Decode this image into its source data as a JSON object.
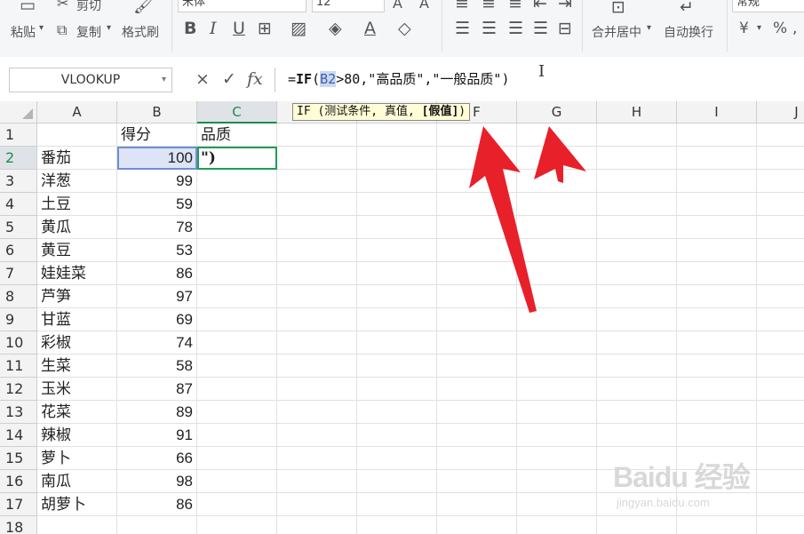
{
  "ribbon": {
    "paste_label": "粘贴",
    "cut_label": "剪切",
    "copy_label": "复制",
    "format_painter_label": "格式刷",
    "font_name": "宋体",
    "font_size": "12",
    "merge_center_label": "合并居中",
    "wrap_text_label": "自动换行",
    "number_format": "常规",
    "currency_symbol": "¥",
    "percent_symbol": "%"
  },
  "formula_bar": {
    "name_box": "VLOOKUP",
    "cancel_symbol": "×",
    "enter_symbol": "✓",
    "fx_label": "fx",
    "formula_prefix": "=",
    "formula_fn": "IF",
    "formula_open": "(",
    "formula_ref": "B2",
    "formula_rest": ">80,\"高品质\",\"一般品质\")"
  },
  "tooltip": {
    "prefix": "IF (测试条件, 真值, ",
    "bold_arg": "[假值]",
    "suffix": ")"
  },
  "columns": [
    "A",
    "B",
    "C",
    "D",
    "E",
    "F",
    "G",
    "H",
    "I",
    "J"
  ],
  "rows": [
    {
      "num": "1",
      "a": "",
      "b": "得分",
      "c": "品质"
    },
    {
      "num": "2",
      "a": "番茄",
      "b": "100",
      "c": "\")"
    },
    {
      "num": "3",
      "a": "洋葱",
      "b": "99",
      "c": ""
    },
    {
      "num": "4",
      "a": "土豆",
      "b": "59",
      "c": ""
    },
    {
      "num": "5",
      "a": "黄瓜",
      "b": "78",
      "c": ""
    },
    {
      "num": "6",
      "a": "黄豆",
      "b": "53",
      "c": ""
    },
    {
      "num": "7",
      "a": "娃娃菜",
      "b": "86",
      "c": ""
    },
    {
      "num": "8",
      "a": "芦笋",
      "b": "97",
      "c": ""
    },
    {
      "num": "9",
      "a": "甘蓝",
      "b": "69",
      "c": ""
    },
    {
      "num": "10",
      "a": "彩椒",
      "b": "74",
      "c": ""
    },
    {
      "num": "11",
      "a": "生菜",
      "b": "58",
      "c": ""
    },
    {
      "num": "12",
      "a": "玉米",
      "b": "87",
      "c": ""
    },
    {
      "num": "13",
      "a": "花菜",
      "b": "89",
      "c": ""
    },
    {
      "num": "14",
      "a": "辣椒",
      "b": "91",
      "c": ""
    },
    {
      "num": "15",
      "a": "萝卜",
      "b": "66",
      "c": ""
    },
    {
      "num": "16",
      "a": "南瓜",
      "b": "98",
      "c": ""
    },
    {
      "num": "17",
      "a": "胡萝卜",
      "b": "86",
      "c": ""
    },
    {
      "num": "18",
      "a": "",
      "b": "",
      "c": ""
    }
  ],
  "watermark": {
    "main": "Baidu 经验",
    "sub": "jingyan.baidu.com"
  },
  "colors": {
    "accent_green": "#1f8a4c",
    "arrow_red": "#e8202a",
    "ref_highlight": "#c9d8f2"
  }
}
